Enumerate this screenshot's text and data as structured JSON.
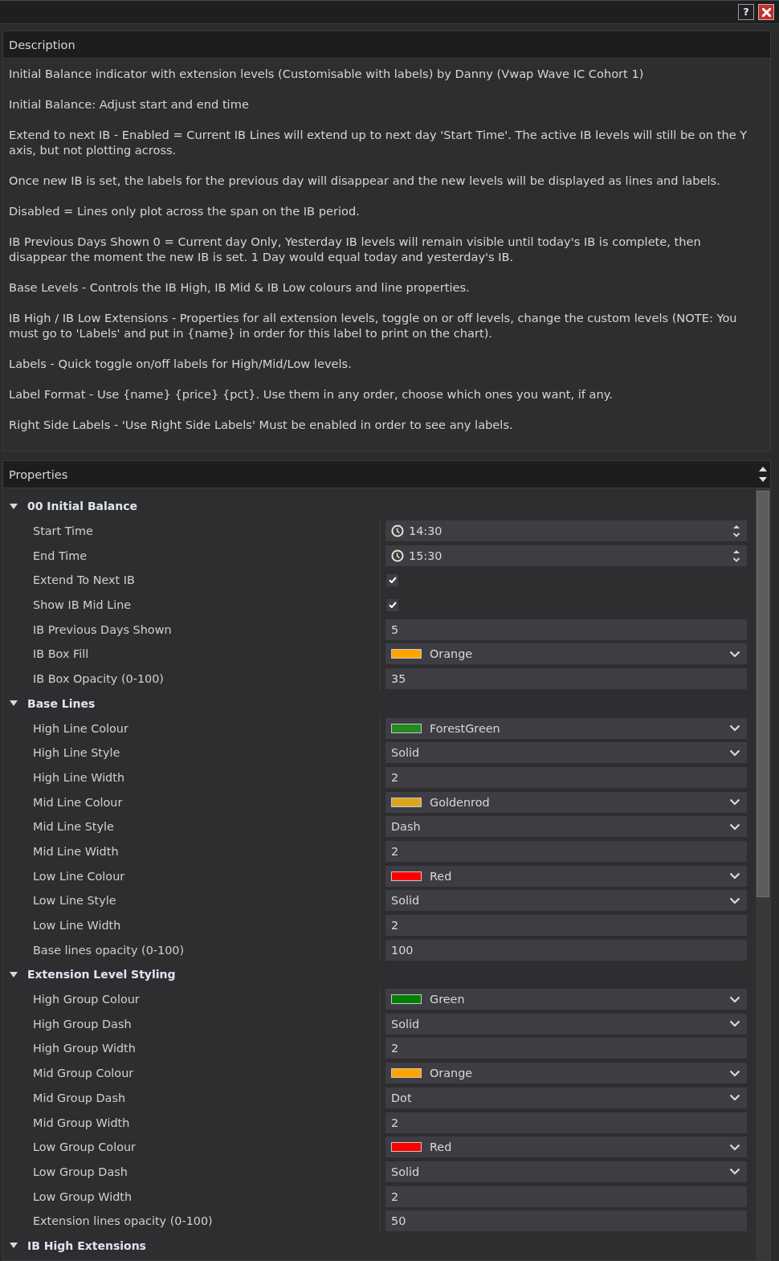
{
  "window": {
    "help_button": "?"
  },
  "description": {
    "title": "Description",
    "paragraphs": [
      "Initial Balance indicator with extension levels (Customisable with labels) by Danny (Vwap Wave IC Cohort 1)",
      "Initial Balance: Adjust start and end time",
      "Extend to next IB - Enabled = Current IB Lines will extend up to next day 'Start Time'. The active IB levels will still be on the Y axis, but not plotting across.",
      "Once new IB is set, the labels for the previous day will disappear and the new levels will be displayed as lines and labels.",
      "Disabled = Lines only plot across the span on the IB period.",
      "IB Previous Days Shown 0 = Current day Only, Yesterday IB levels will remain visible until today's IB is complete, then disappear the moment the new IB is set. 1 Day would equal today and yesterday's IB.",
      "Base Levels - Controls the IB High, IB Mid & IB Low colours and line properties.",
      "IB High / IB Low Extensions - Properties for all extension levels, toggle on or off levels, change the custom levels (NOTE: You must go to 'Labels' and put in {name} in order for this label to print on the chart).",
      "Labels - Quick toggle on/off labels for High/Mid/Low levels.",
      "Label Format - Use {name} {price} {pct}. Use them in any order, choose which ones you want, if any.",
      "Right Side Labels - 'Use Right Side Labels' Must be enabled in order to see any labels."
    ]
  },
  "properties": {
    "title": "Properties",
    "groups": [
      {
        "name": "00 Initial Balance",
        "expanded": true,
        "items": [
          {
            "label": "Start Time",
            "kind": "time",
            "value": "14:30"
          },
          {
            "label": "End Time",
            "kind": "time",
            "value": "15:30"
          },
          {
            "label": "Extend To Next IB",
            "kind": "checkbox",
            "checked": true
          },
          {
            "label": "Show IB Mid Line",
            "kind": "checkbox",
            "checked": true
          },
          {
            "label": "IB Previous Days Shown",
            "kind": "number",
            "value": "5"
          },
          {
            "label": "IB Box Fill",
            "kind": "color",
            "value": "Orange",
            "color": "#ffa500"
          },
          {
            "label": "IB Box Opacity (0-100)",
            "kind": "number",
            "value": "35"
          }
        ]
      },
      {
        "name": "Base Lines",
        "expanded": true,
        "items": [
          {
            "label": "High Line Colour",
            "kind": "color",
            "value": "ForestGreen",
            "color": "#228b22"
          },
          {
            "label": "High Line Style",
            "kind": "select",
            "value": "Solid"
          },
          {
            "label": "High Line Width",
            "kind": "number",
            "value": "2"
          },
          {
            "label": "Mid Line Colour",
            "kind": "color",
            "value": "Goldenrod",
            "color": "#daa520"
          },
          {
            "label": "Mid Line Style",
            "kind": "select",
            "value": "Dash"
          },
          {
            "label": "Mid Line Width",
            "kind": "number",
            "value": "2"
          },
          {
            "label": "Low Line Colour",
            "kind": "color",
            "value": "Red",
            "color": "#ff0000"
          },
          {
            "label": "Low Line Style",
            "kind": "select",
            "value": "Solid"
          },
          {
            "label": "Low Line Width",
            "kind": "number",
            "value": "2"
          },
          {
            "label": "Base lines opacity (0-100)",
            "kind": "number",
            "value": "100"
          }
        ]
      },
      {
        "name": "Extension Level Styling",
        "expanded": true,
        "items": [
          {
            "label": "High Group Colour",
            "kind": "color",
            "value": "Green",
            "color": "#008000"
          },
          {
            "label": "High Group Dash",
            "kind": "select",
            "value": "Solid"
          },
          {
            "label": "High Group Width",
            "kind": "number",
            "value": "2"
          },
          {
            "label": "Mid Group Colour",
            "kind": "color",
            "value": "Orange",
            "color": "#ffa500"
          },
          {
            "label": "Mid Group Dash",
            "kind": "select",
            "value": "Dot"
          },
          {
            "label": "Mid Group Width",
            "kind": "number",
            "value": "2"
          },
          {
            "label": "Low Group Colour",
            "kind": "color",
            "value": "Red",
            "color": "#ff0000"
          },
          {
            "label": "Low Group Dash",
            "kind": "select",
            "value": "Solid"
          },
          {
            "label": "Low Group Width",
            "kind": "number",
            "value": "2"
          },
          {
            "label": "Extension lines opacity (0-100)",
            "kind": "number",
            "value": "50"
          }
        ]
      },
      {
        "name": "IB High Extensions",
        "expanded": true
      }
    ]
  }
}
